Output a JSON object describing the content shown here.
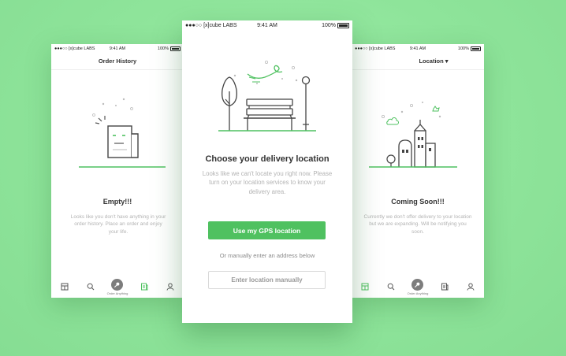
{
  "colors": {
    "accent": "#4fc160",
    "background": "#8ee49a",
    "icon_gray": "#555555"
  },
  "screens": {
    "left": {
      "status": {
        "carrier": "●●●○○ [x]cube LABS",
        "time": "9:41 AM",
        "battery": "100%"
      },
      "nav_title": "Order History",
      "headline": "Empty!!!",
      "body": "Looks like you don't have anything in your order history. Place an order and enjoy your life.",
      "tab_center_caption": "Order Anything",
      "illustration_icon": "receipt-empty-icon"
    },
    "center": {
      "status": {
        "carrier": "●●●○○ [x]cube LABS",
        "time": "9:41 AM",
        "battery": "100%"
      },
      "headline": "Choose your delivery location",
      "body": "Looks like we can't locate you right now. Please turn on your location services to know your delivery area.",
      "primary_button": "Use my GPS location",
      "or_text": "Or manually enter an address below",
      "secondary_button": "Enter location manually",
      "illustration_icon": "park-bench-icon"
    },
    "right": {
      "status": {
        "carrier": "●●●○○ [x]cube LABS",
        "time": "9:41 AM",
        "battery": "100%"
      },
      "nav_title": "Location ▾",
      "headline": "Coming Soon!!!",
      "body": "Currently we don't offer delivery to your location but we are expanding. Will be notifying you soon.",
      "tab_center_caption": "Order Anything",
      "illustration_icon": "city-buildings-icon"
    }
  },
  "tabbar_icons": [
    "store-icon",
    "search-icon",
    "order-anything-icon",
    "orders-icon",
    "profile-icon"
  ]
}
